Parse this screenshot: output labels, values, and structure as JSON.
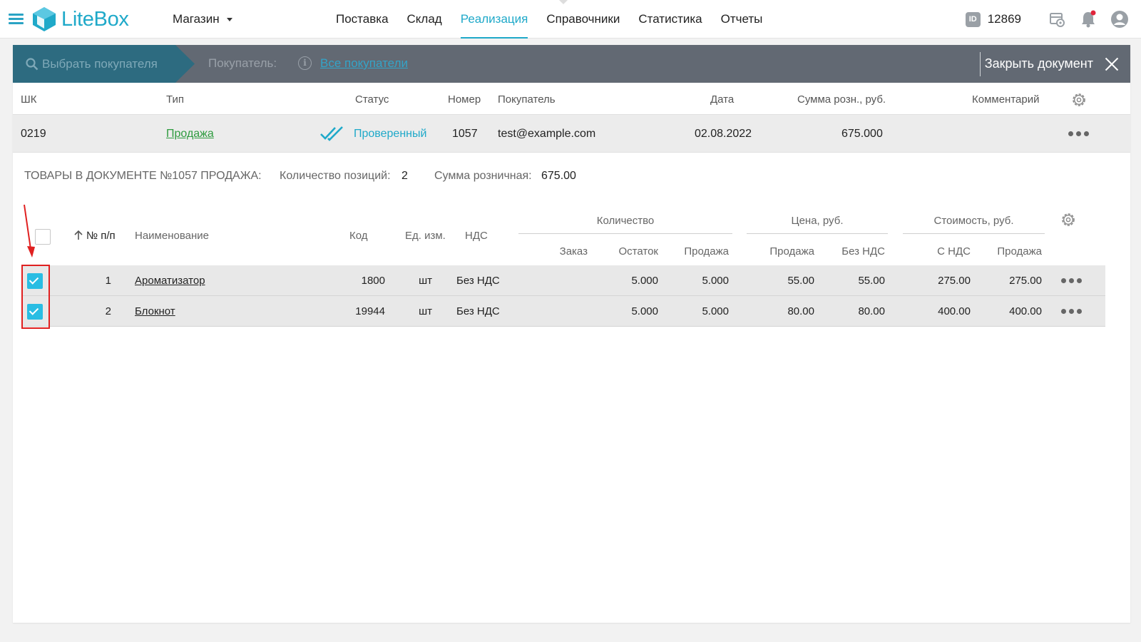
{
  "header": {
    "logo_text": "LiteBox",
    "store_label": "Магазин",
    "nav": [
      {
        "label": "Поставка"
      },
      {
        "label": "Склад"
      },
      {
        "label": "Реализация",
        "active": true
      },
      {
        "label": "Справочники"
      },
      {
        "label": "Статистика"
      },
      {
        "label": "Отчеты"
      }
    ],
    "id_badge": "ID",
    "id_value": "12869",
    "icons": [
      "menu-icon",
      "store-settings-icon",
      "bell-icon",
      "user-icon"
    ],
    "accent_color": "#1fa9c9"
  },
  "buyer_bar": {
    "select_label": "Выбрать покупателя",
    "buyer_label": "Покупатель:",
    "buyer_link": "Все покупатели",
    "close_label": "Закрыть документ"
  },
  "doc_table": {
    "headers": {
      "barcode": "ШК",
      "type": "Тип",
      "status": "Статус",
      "number": "Номер",
      "buyer": "Покупатель",
      "date": "Дата",
      "sum": "Сумма розн., руб.",
      "comment": "Комментарий"
    },
    "row": {
      "barcode": "0219",
      "type": "Продажа",
      "status": "Проверенный",
      "number": "1057",
      "buyer": "test@example.com",
      "date": "02.08.2022",
      "sum": "675.000",
      "comment": ""
    }
  },
  "summary": {
    "title": "ТОВАРЫ В ДОКУМЕНТЕ №1057 ПРОДАЖА:",
    "count_label": "Количество позиций:",
    "count_value": "2",
    "sum_label": "Сумма розничная:",
    "sum_value": "675.00"
  },
  "items_table": {
    "headers": {
      "num": "№ п/п",
      "name": "Наименование",
      "code": "Код",
      "unit": "Ед. изм.",
      "vat": "НДС",
      "qty_group": "Количество",
      "price_group": "Цена, руб.",
      "cost_group": "Стоимость, руб.",
      "order": "Заказ",
      "remain": "Остаток",
      "sale_qty": "Продажа",
      "price_sale": "Продажа",
      "price_novat": "Без НДС",
      "cost_vat": "С НДС",
      "cost_sale": "Продажа"
    },
    "rows": [
      {
        "checked": true,
        "num": "1",
        "name": "Ароматизатор",
        "code": "1800",
        "unit": "шт",
        "vat": "Без НДС",
        "order": "",
        "remain": "5.000",
        "sale_qty": "5.000",
        "price_sale": "55.00",
        "price_novat": "55.00",
        "cost_vat": "275.00",
        "cost_sale": "275.00"
      },
      {
        "checked": true,
        "num": "2",
        "name": "Блокнот",
        "code": "19944",
        "unit": "шт",
        "vat": "Без НДС",
        "order": "",
        "remain": "5.000",
        "sale_qty": "5.000",
        "price_sale": "80.00",
        "price_novat": "80.00",
        "cost_vat": "400.00",
        "cost_sale": "400.00"
      }
    ]
  }
}
